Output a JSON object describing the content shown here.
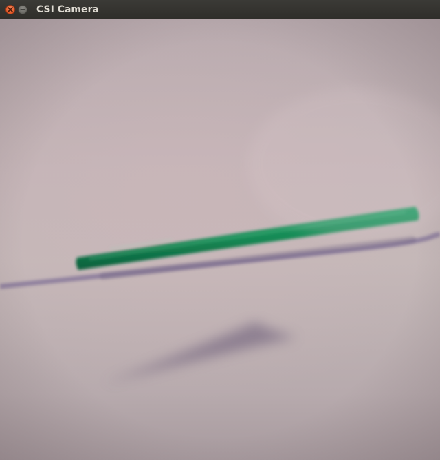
{
  "window": {
    "title": "CSI Camera"
  },
  "controls": {
    "close_icon": "close-icon",
    "minimize_icon": "minimize-icon"
  },
  "colors": {
    "close": "#e65a27",
    "minimize": "#6a6964",
    "titlebar": "#3b3a36",
    "title_text": "#dfdbd2",
    "pencil": "#1a8a55",
    "background": "#c4b8b8"
  }
}
